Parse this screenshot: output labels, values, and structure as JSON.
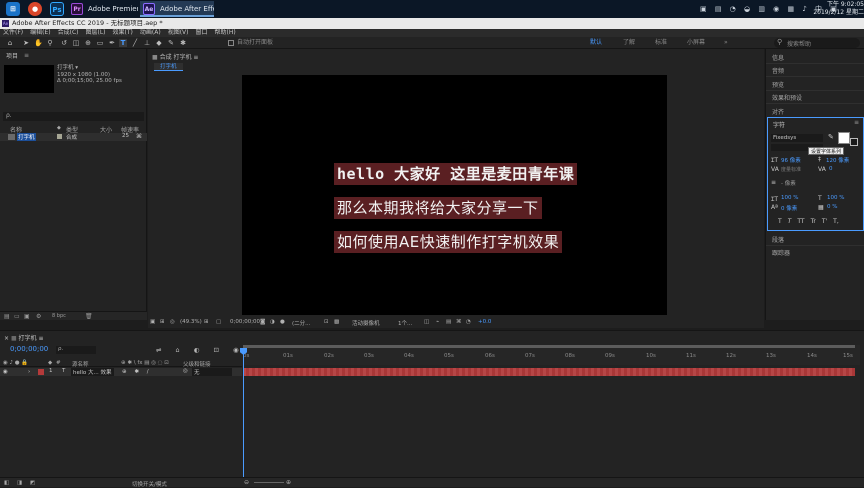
{
  "taskbar": {
    "apps": [
      {
        "icon": "Pr",
        "label": "Adobe Premiere ..."
      },
      {
        "icon": "Ae",
        "label": "Adobe After Effec..."
      }
    ],
    "clock_time": "下午 9:02:05",
    "clock_date": "2019/2/12 星期二"
  },
  "window": {
    "title": "Adobe After Effects CC 2019 - 无标题项目.aep *"
  },
  "menu": [
    "文件(F)",
    "编辑(E)",
    "合成(C)",
    "图层(L)",
    "效果(T)",
    "动画(A)",
    "视图(V)",
    "窗口",
    "帮助(H)"
  ],
  "toolbar": {
    "auto_open": "自动打开面板",
    "workspaces": [
      "默认",
      "了解",
      "标准",
      "小屏幕"
    ],
    "search_placeholder": "搜索帮助"
  },
  "project": {
    "title": "项目",
    "thumb_name": "打字机 ▾",
    "thumb_info1": "1920 x 1080 (1.00)",
    "thumb_info2": "Δ 0;00;15;00, 25.00 fps",
    "search_icon_label": "ρ.",
    "columns": [
      "名称",
      "类型",
      "大小",
      "帧速率"
    ],
    "item_name": "打字机",
    "item_type": "合成",
    "item_fps": "25",
    "bpc": "8 bpc"
  },
  "composition": {
    "tab_label": "合成 打字机",
    "sub_tab": "打字机",
    "lines": [
      "hello 大家好 这里是麦田青年课",
      "那么本期我将给大家分享一下",
      "如何使用AE快速制作打字机效果"
    ],
    "zoom": "(49.3%)",
    "timecode": "0;00;00;00",
    "resolution": "(二分...",
    "camera": "活动摄像机",
    "views": "1个...",
    "exposure": "+0.0"
  },
  "right": {
    "items": [
      "信息",
      "音频",
      "预览",
      "效果和预设",
      "对齐"
    ],
    "character_title": "字符",
    "font": "Fixedsys",
    "tooltip": "设置字体系列",
    "size": "96 像素",
    "leading": "120 像素",
    "tracking_label": "度量标准",
    "tracking": "0",
    "stroke": "- 像素",
    "scale_v": "100 %",
    "scale_h": "100 %",
    "baseline": "0 像素",
    "tsume": "0 %",
    "styles": [
      "T",
      "T",
      "TT",
      "Tr",
      "T'",
      "T,"
    ],
    "lower_items": [
      "段落",
      "跟踪器"
    ]
  },
  "timeline": {
    "tab_label": "打字机",
    "timecode": "0;00;00;00",
    "ruler": [
      "0s",
      "01s",
      "02s",
      "03s",
      "04s",
      "05s",
      "06s",
      "07s",
      "08s",
      "09s",
      "10s",
      "11s",
      "12s",
      "13s",
      "14s",
      "15s"
    ],
    "col_source": "源名称",
    "col_parent": "父级和链接",
    "layer_num": "1",
    "layer_name": "hello 大... 效果",
    "layer_parent": "无",
    "footer": "切换开关/模式"
  }
}
